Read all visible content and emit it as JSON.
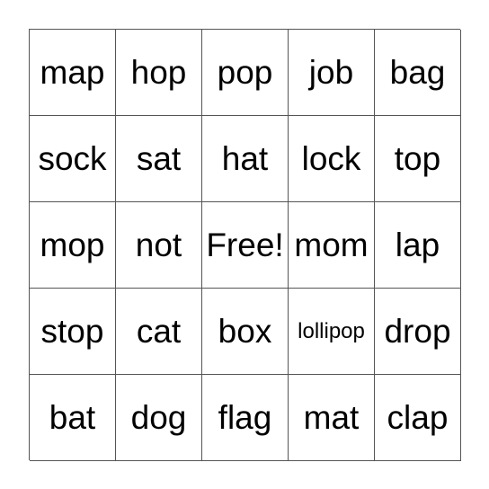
{
  "board": {
    "rows": [
      [
        "map",
        "hop",
        "pop",
        "job",
        "bag"
      ],
      [
        "sock",
        "sat",
        "hat",
        "lock",
        "top"
      ],
      [
        "mop",
        "not",
        "Free!",
        "mom",
        "lap"
      ],
      [
        "stop",
        "cat",
        "box",
        "lollipop",
        "drop"
      ],
      [
        "bat",
        "dog",
        "flag",
        "mat",
        "clap"
      ]
    ]
  }
}
